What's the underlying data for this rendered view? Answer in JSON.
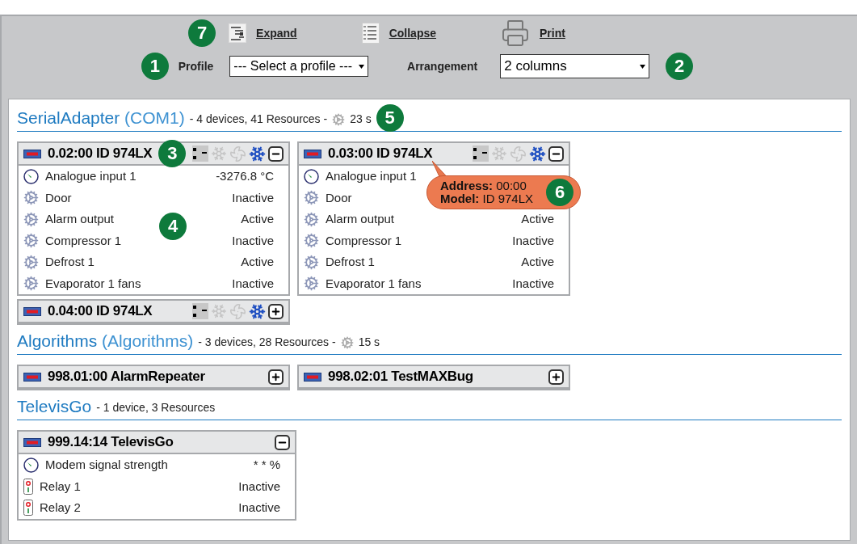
{
  "toolbar": {
    "callout": "7",
    "actions": [
      {
        "kind": "expand",
        "label": "Expand"
      },
      {
        "kind": "collapse",
        "label": "Collapse"
      },
      {
        "kind": "print",
        "label": "Print"
      }
    ],
    "profile": {
      "callout": "1",
      "label": "Profile",
      "value": "--- Select a profile ---"
    },
    "arrangement": {
      "label": "Arrangement",
      "value": "2 columns",
      "callout": "2"
    }
  },
  "groups": [
    {
      "name": "SerialAdapter",
      "sub": "(COM1)",
      "summary": "- 4 devices, 41 Resources -",
      "poll": "23 s",
      "callout": "5",
      "devices": [
        {
          "address": "0.02:00",
          "model": "ID 974LX",
          "expanded": true,
          "callout": "3",
          "body_callout": "4",
          "indicators": [
            {
              "kind": "display",
              "on": true
            },
            {
              "kind": "defrost",
              "on": false
            },
            {
              "kind": "fan",
              "on": false
            },
            {
              "kind": "cooling",
              "on": true
            }
          ],
          "resources": [
            {
              "kind": "analog",
              "name": "Analogue input 1",
              "value": "-3276.8 °C"
            },
            {
              "kind": "digital",
              "name": "Door",
              "value": "Inactive"
            },
            {
              "kind": "digital",
              "name": "Alarm output",
              "value": "Active"
            },
            {
              "kind": "digital",
              "name": "Compressor 1",
              "value": "Inactive"
            },
            {
              "kind": "digital",
              "name": "Defrost 1",
              "value": "Active"
            },
            {
              "kind": "digital",
              "name": "Evaporator 1 fans",
              "value": "Inactive"
            }
          ]
        },
        {
          "address": "0.03:00",
          "model": "ID 974LX",
          "expanded": true,
          "indicators": [
            {
              "kind": "display",
              "on": true
            },
            {
              "kind": "defrost",
              "on": false
            },
            {
              "kind": "fan",
              "on": false
            },
            {
              "kind": "cooling",
              "on": true
            }
          ],
          "tooltip": {
            "address_label": "Address:",
            "address": "00:00",
            "model_label": "Model:",
            "model": "ID 974LX",
            "callout": "6"
          },
          "resources": [
            {
              "kind": "analog",
              "name": "Analogue input 1"
            },
            {
              "kind": "digital",
              "name": "Door"
            },
            {
              "kind": "digital",
              "name": "Alarm output",
              "value": "Active"
            },
            {
              "kind": "digital",
              "name": "Compressor 1",
              "value": "Inactive"
            },
            {
              "kind": "digital",
              "name": "Defrost 1",
              "value": "Active"
            },
            {
              "kind": "digital",
              "name": "Evaporator 1 fans",
              "value": "Inactive"
            }
          ]
        },
        {
          "address": "0.04:00",
          "model": "ID 974LX",
          "expanded": false,
          "indicators": [
            {
              "kind": "display",
              "on": true
            },
            {
              "kind": "defrost",
              "on": false
            },
            {
              "kind": "fan",
              "on": false
            },
            {
              "kind": "cooling",
              "on": true
            }
          ]
        }
      ]
    },
    {
      "name": "Algorithms",
      "sub": "(Algorithms)",
      "summary": "- 3 devices, 28 Resources -",
      "poll": "15 s",
      "devices": [
        {
          "address": "998.01:00",
          "model": "AlarmRepeater",
          "expanded": false
        },
        {
          "address": "998.02:01",
          "model": "TestMAXBug",
          "expanded": false
        }
      ]
    },
    {
      "name": "TelevisGo",
      "summary": "- 1 device, 3 Resources",
      "devices": [
        {
          "address": "999.14:14",
          "model": "TelevisGo",
          "expanded": true,
          "resources": [
            {
              "kind": "analog",
              "name": "Modem signal strength",
              "value": "* * %"
            },
            {
              "kind": "relay",
              "name": "Relay 1",
              "value": "Inactive"
            },
            {
              "kind": "relay",
              "name": "Relay 2",
              "value": "Inactive"
            }
          ]
        }
      ]
    }
  ]
}
